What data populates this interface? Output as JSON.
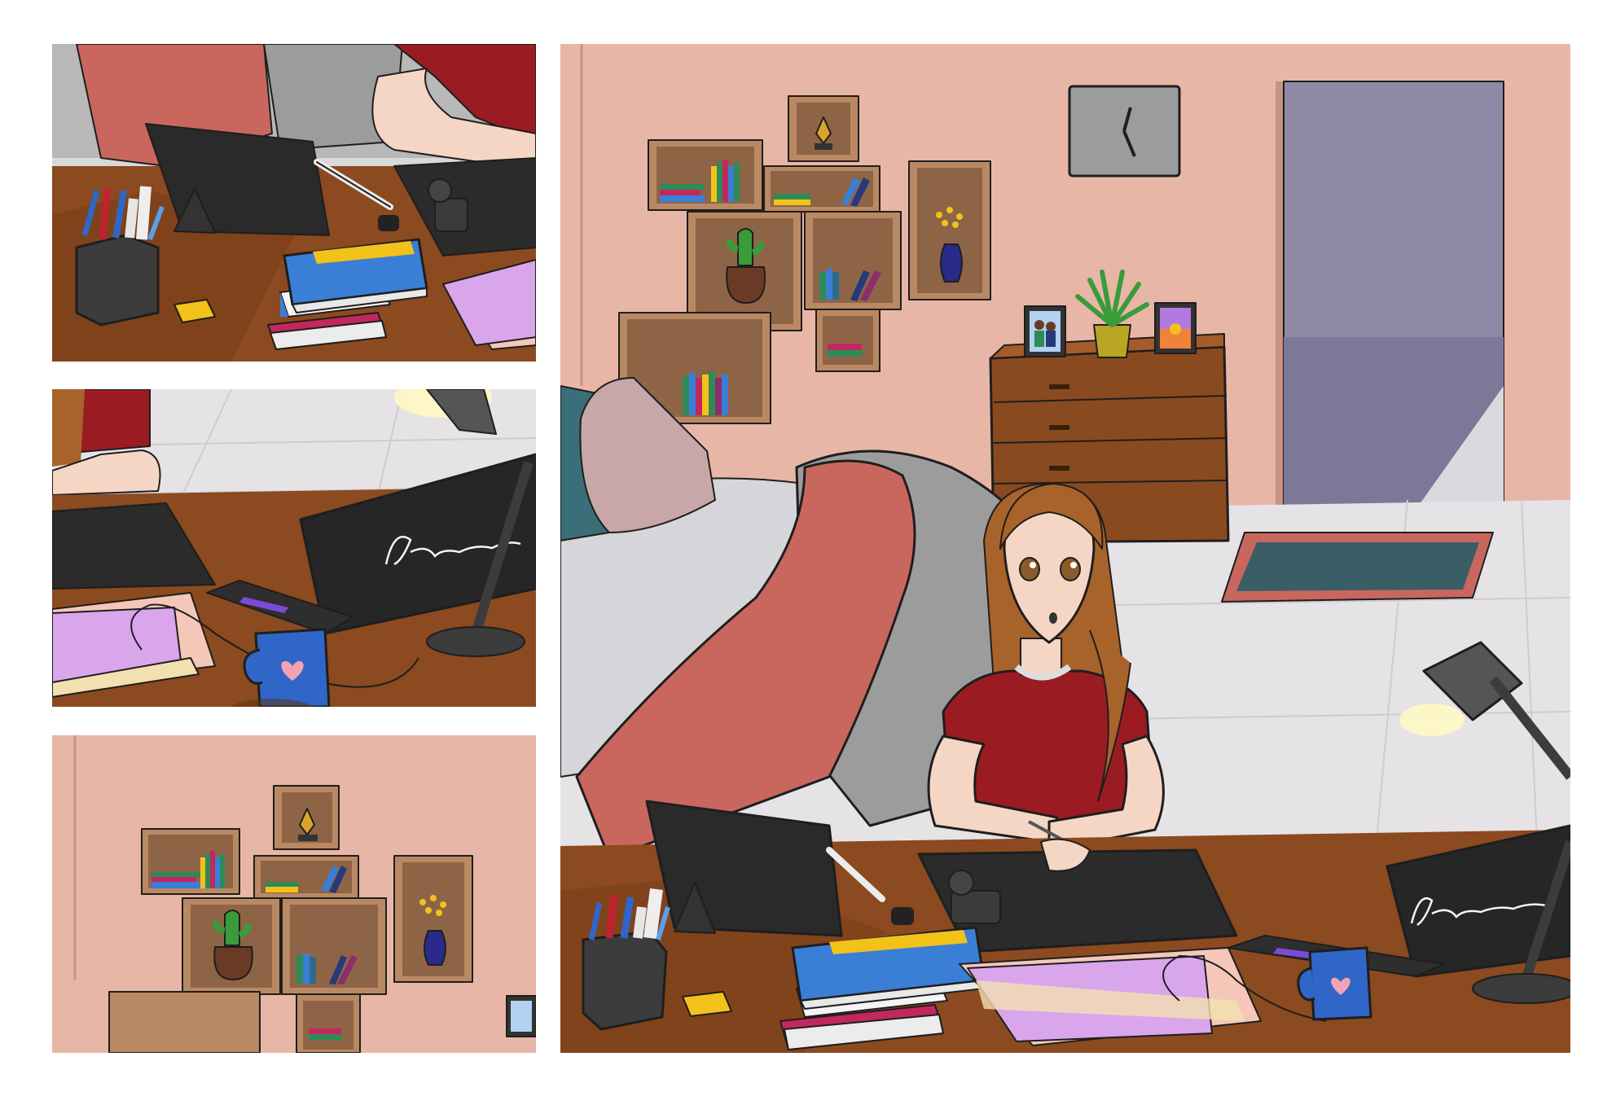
{
  "image": {
    "layout": "comic-strip",
    "panels": [
      {
        "id": "panel-1",
        "content": "desk-closeup-books-pens-tablet"
      },
      {
        "id": "panel-2",
        "content": "desk-closeup-laptop-mug-lamp"
      },
      {
        "id": "panel-3",
        "content": "wall-shelves-closeup"
      },
      {
        "id": "panel-4",
        "content": "bedroom-wide-shot-girl-at-desk"
      }
    ],
    "icons": [
      "heart-icon",
      "clock-icon",
      "pen-nib-icon",
      "cactus-icon",
      "plant-icon",
      "flower-vase-icon",
      "lamp-icon",
      "laptop-icon",
      "mug-icon",
      "book-stack-icon"
    ]
  },
  "colors": {
    "wall": "#e8b6a6",
    "floor": "#e6e3e6",
    "desk": "#8b4a1f",
    "shirt": "#9b1b23",
    "hair": "#a8632a",
    "blanket": "#c9675f",
    "bed_gray": "#9c9c9c",
    "doorway": "#8e8aa6",
    "mug": "#2f66c7",
    "paper_purple": "#d9a6ec",
    "paper_pink": "#f4c7b8",
    "book_blue": "#3a7ed6",
    "book_yellow": "#f2c21a",
    "book_magenta": "#c2285e",
    "shelf_wood": "#b98963",
    "dresser": "#8a4a1f"
  }
}
